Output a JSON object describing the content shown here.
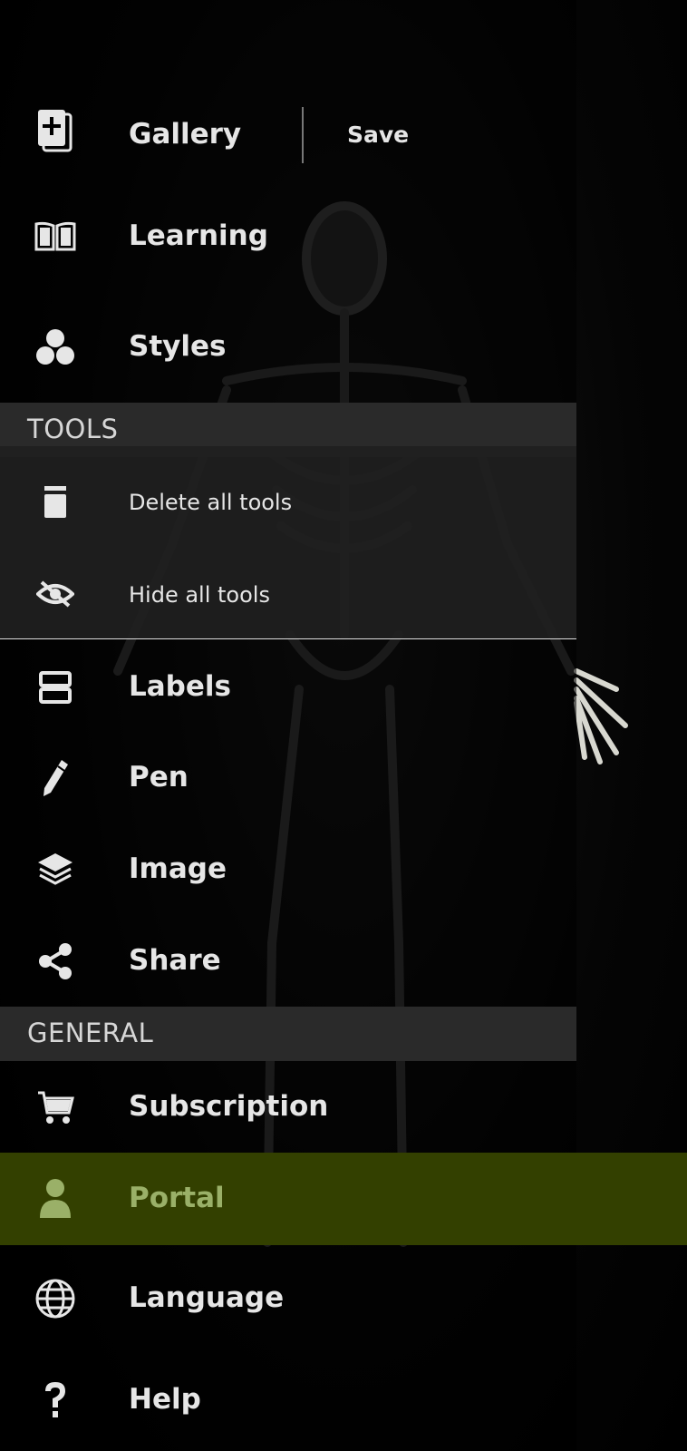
{
  "colors": {
    "drawer_bg": "#0a0a0a",
    "section_bg": "#2a2a2a",
    "portal_highlight": "#334000",
    "portal_text": "#9ab068"
  },
  "header": {
    "gallery_label": "Gallery",
    "save_label": "Save"
  },
  "menu_top": [
    {
      "id": "learning",
      "label": "Learning",
      "icon": "book-icon"
    },
    {
      "id": "styles",
      "label": "Styles",
      "icon": "circles-icon"
    }
  ],
  "tools_section": {
    "title": "TOOLS",
    "items": [
      {
        "id": "delete-all-tools",
        "label": "Delete all tools",
        "icon": "trash-icon"
      },
      {
        "id": "hide-all-tools",
        "label": "Hide all tools",
        "icon": "eye-off-icon"
      }
    ]
  },
  "tools_menu": [
    {
      "id": "labels",
      "label": "Labels",
      "icon": "labels-icon"
    },
    {
      "id": "pen",
      "label": "Pen",
      "icon": "pen-icon"
    },
    {
      "id": "image",
      "label": "Image",
      "icon": "layers-icon"
    },
    {
      "id": "share",
      "label": "Share",
      "icon": "share-icon"
    }
  ],
  "general_section": {
    "title": "GENERAL",
    "items": [
      {
        "id": "subscription",
        "label": "Subscription",
        "icon": "cart-icon"
      },
      {
        "id": "portal",
        "label": "Portal",
        "icon": "person-icon",
        "selected": true
      },
      {
        "id": "language",
        "label": "Language",
        "icon": "globe-icon"
      },
      {
        "id": "help",
        "label": "Help",
        "icon": "question-icon"
      }
    ]
  }
}
